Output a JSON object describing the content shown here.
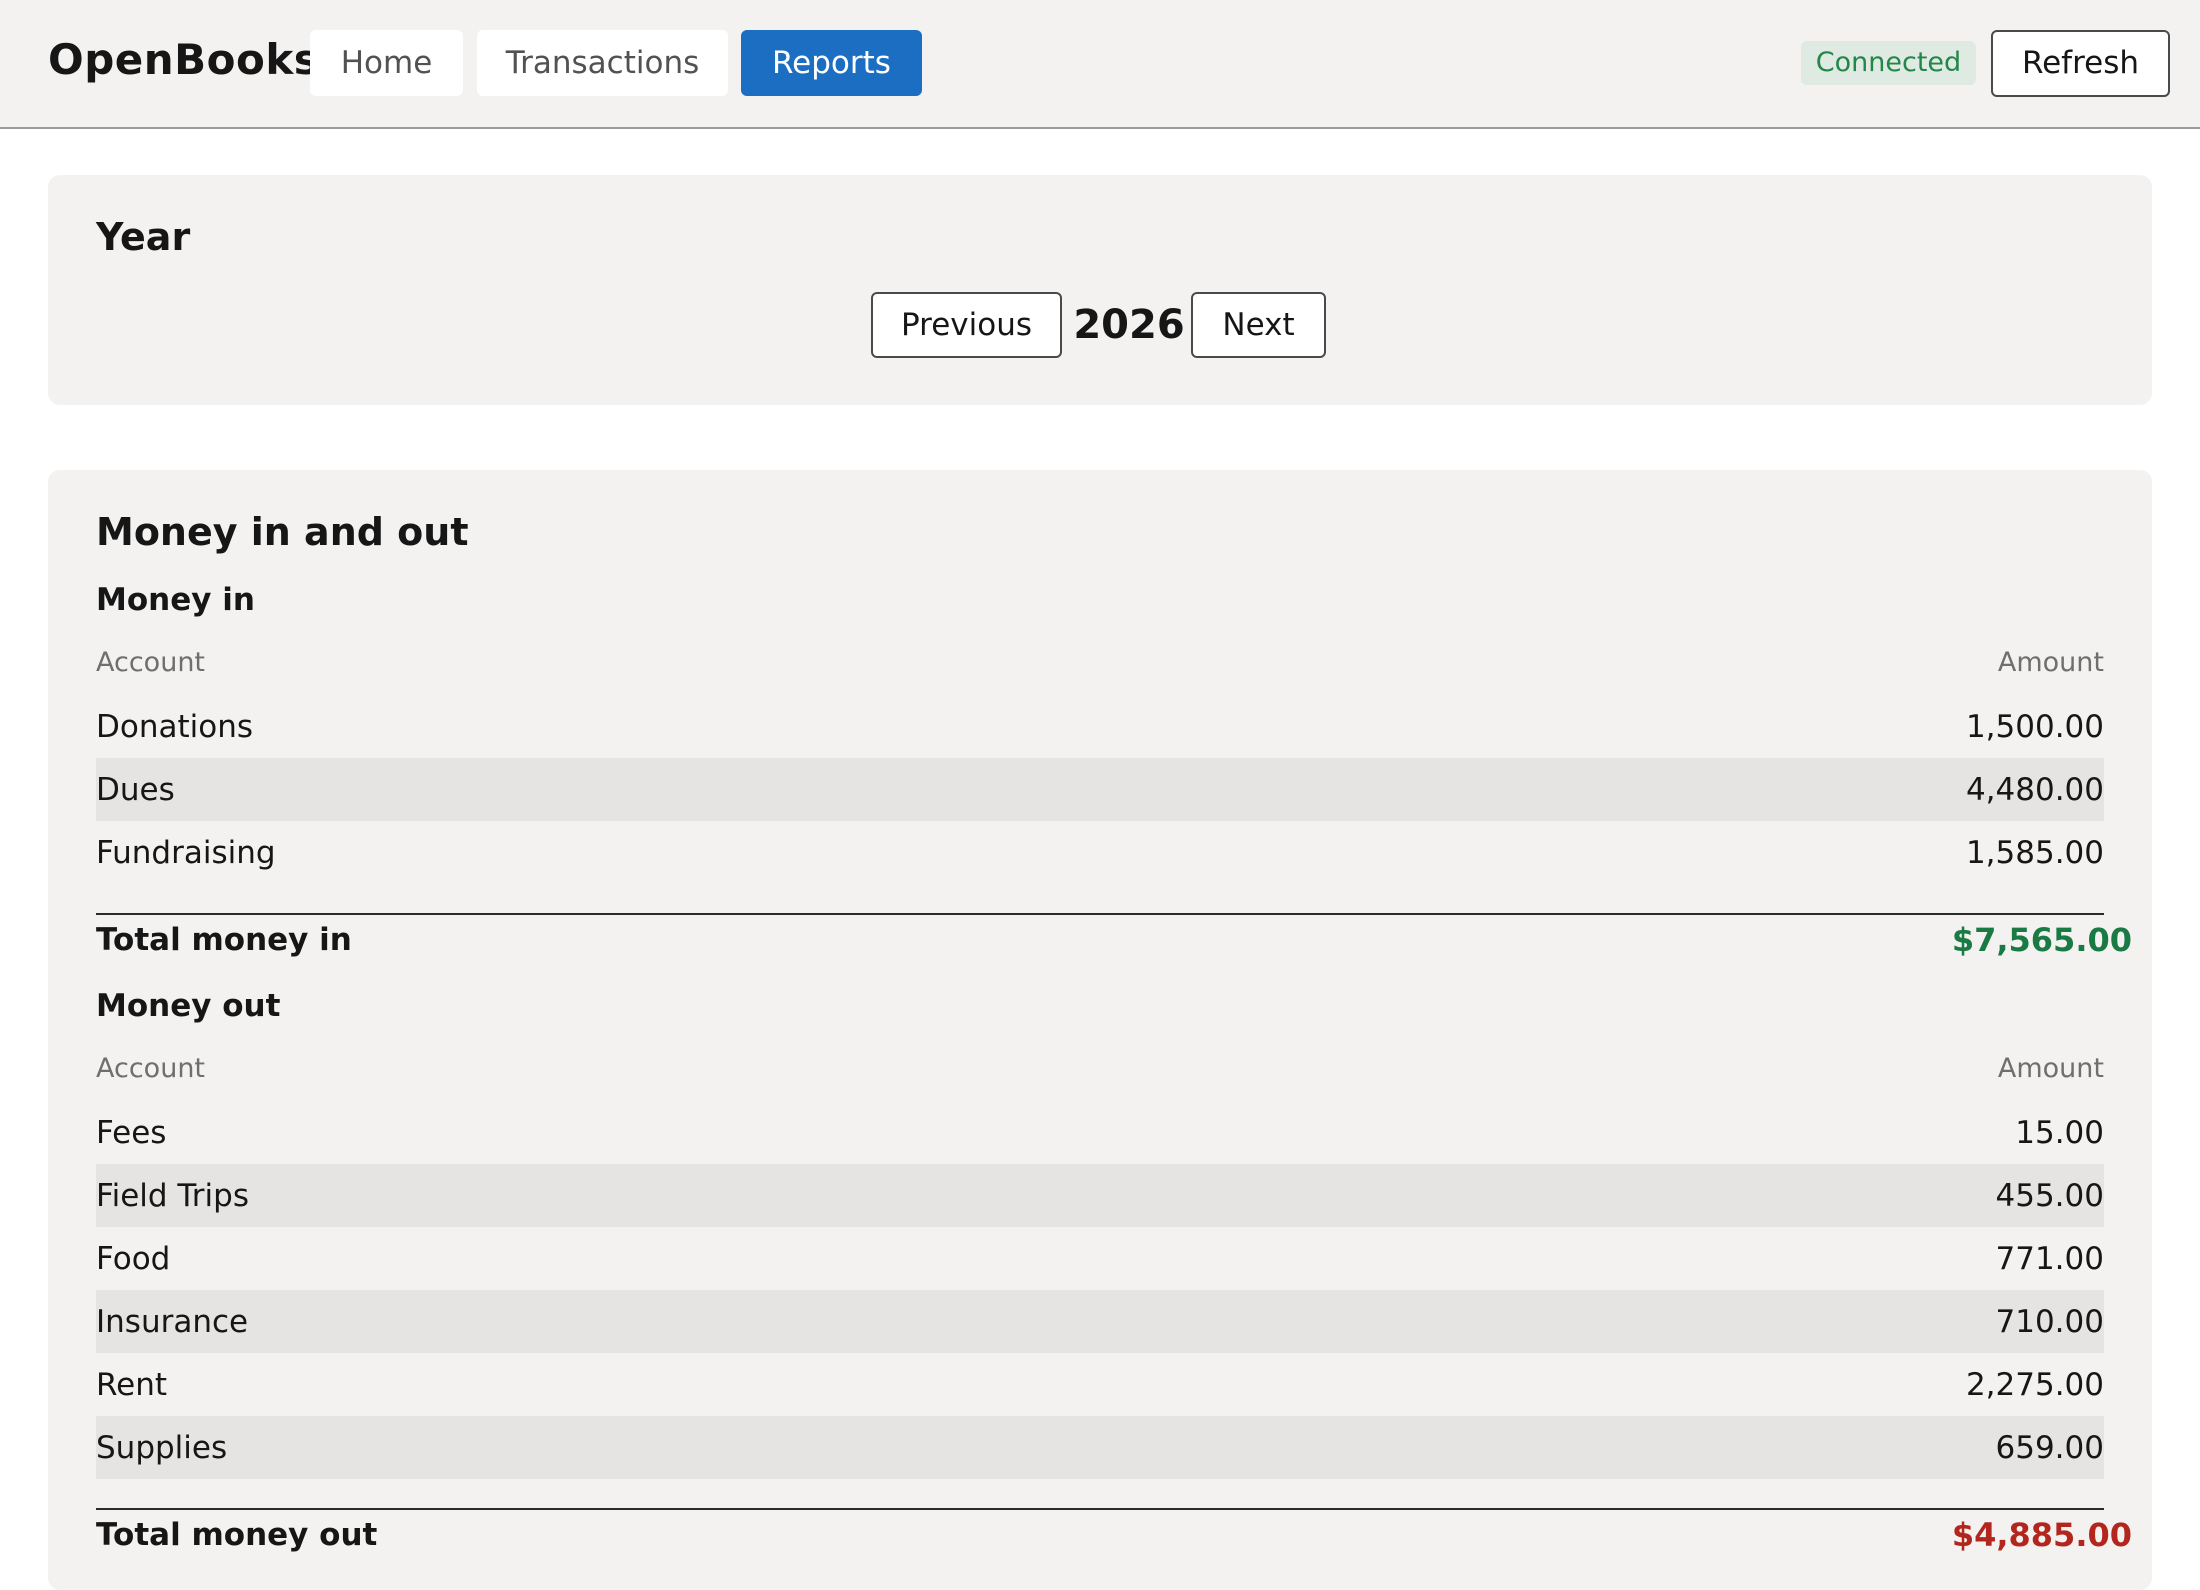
{
  "header": {
    "brand": "OpenBooks",
    "nav": {
      "home": "Home",
      "transactions": "Transactions",
      "reports": "Reports"
    },
    "active_tab": "Reports",
    "status": "Connected",
    "refresh_label": "Refresh"
  },
  "year_panel": {
    "title": "Year",
    "previous_label": "Previous",
    "year": "2026",
    "next_label": "Next"
  },
  "report": {
    "title": "Money in and out",
    "money_in": {
      "heading": "Money in",
      "columns": {
        "account": "Account",
        "amount": "Amount"
      },
      "rows": [
        {
          "account": "Donations",
          "amount": "1,500.00"
        },
        {
          "account": "Dues",
          "amount": "4,480.00"
        },
        {
          "account": "Fundraising",
          "amount": "1,585.00"
        }
      ],
      "total_label": "Total money in",
      "total_value": "$7,565.00"
    },
    "money_out": {
      "heading": "Money out",
      "columns": {
        "account": "Account",
        "amount": "Amount"
      },
      "rows": [
        {
          "account": "Fees",
          "amount": "15.00"
        },
        {
          "account": "Field Trips",
          "amount": "455.00"
        },
        {
          "account": "Food",
          "amount": "771.00"
        },
        {
          "account": "Insurance",
          "amount": "710.00"
        },
        {
          "account": "Rent",
          "amount": "2,275.00"
        },
        {
          "account": "Supplies",
          "amount": "659.00"
        }
      ],
      "total_label": "Total money out",
      "total_value": "$4,885.00"
    }
  },
  "colors": {
    "accent": "#1b6ec2",
    "positive": "#1a7a44",
    "negative": "#b3261e",
    "status_bg": "#dfeae2",
    "status_text": "#23874a",
    "panel_bg": "#f3f2f1",
    "row_alt_bg": "#e5e4e3"
  }
}
